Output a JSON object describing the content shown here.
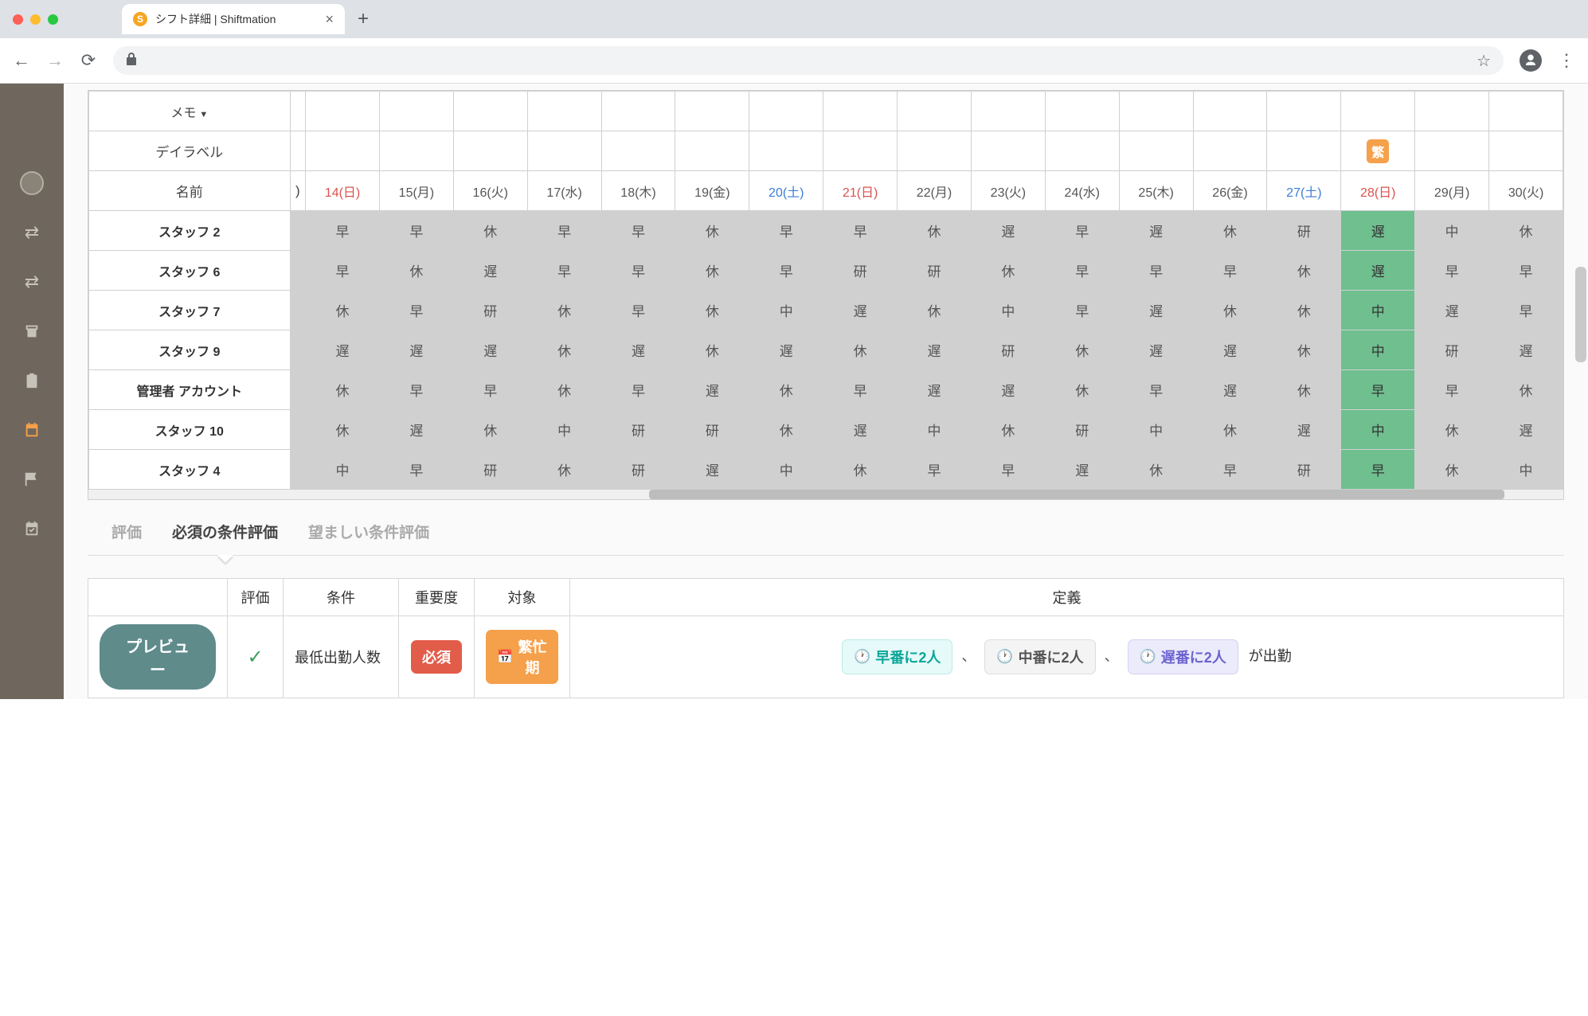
{
  "browser": {
    "tab_title": "シフト詳細 | Shiftmation"
  },
  "schedule": {
    "memo_label": "メモ",
    "daylabel_label": "デイラベル",
    "name_label": "名前",
    "busy_tag": "繁",
    "dates": [
      {
        "label": ")",
        "type": ""
      },
      {
        "label": "14(日)",
        "type": "sun"
      },
      {
        "label": "15(月)",
        "type": ""
      },
      {
        "label": "16(火)",
        "type": ""
      },
      {
        "label": "17(水)",
        "type": ""
      },
      {
        "label": "18(木)",
        "type": ""
      },
      {
        "label": "19(金)",
        "type": ""
      },
      {
        "label": "20(土)",
        "type": "sat"
      },
      {
        "label": "21(日)",
        "type": "sun"
      },
      {
        "label": "22(月)",
        "type": ""
      },
      {
        "label": "23(火)",
        "type": ""
      },
      {
        "label": "24(水)",
        "type": ""
      },
      {
        "label": "25(木)",
        "type": ""
      },
      {
        "label": "26(金)",
        "type": ""
      },
      {
        "label": "27(土)",
        "type": "sat"
      },
      {
        "label": "28(日)",
        "type": "sun"
      },
      {
        "label": "29(月)",
        "type": ""
      },
      {
        "label": "30(火)",
        "type": ""
      }
    ],
    "rows": [
      {
        "name": "スタッフ 2",
        "shifts": [
          "",
          "早",
          "早",
          "休",
          "早",
          "早",
          "休",
          "早",
          "早",
          "休",
          "遅",
          "早",
          "遅",
          "休",
          "研",
          "遅",
          "中",
          "休"
        ]
      },
      {
        "name": "スタッフ 6",
        "shifts": [
          "",
          "早",
          "休",
          "遅",
          "早",
          "早",
          "休",
          "早",
          "研",
          "研",
          "休",
          "早",
          "早",
          "早",
          "休",
          "遅",
          "早",
          "早"
        ]
      },
      {
        "name": "スタッフ 7",
        "shifts": [
          "",
          "休",
          "早",
          "研",
          "休",
          "早",
          "休",
          "中",
          "遅",
          "休",
          "中",
          "早",
          "遅",
          "休",
          "休",
          "中",
          "遅",
          "早"
        ]
      },
      {
        "name": "スタッフ 9",
        "shifts": [
          "",
          "遅",
          "遅",
          "遅",
          "休",
          "遅",
          "休",
          "遅",
          "休",
          "遅",
          "研",
          "休",
          "遅",
          "遅",
          "休",
          "中",
          "研",
          "遅"
        ]
      },
      {
        "name": "管理者 アカウント",
        "shifts": [
          "",
          "休",
          "早",
          "早",
          "休",
          "早",
          "遅",
          "休",
          "早",
          "遅",
          "遅",
          "休",
          "早",
          "遅",
          "休",
          "早",
          "早",
          "休"
        ]
      },
      {
        "name": "スタッフ 10",
        "shifts": [
          "",
          "休",
          "遅",
          "休",
          "中",
          "研",
          "研",
          "休",
          "遅",
          "中",
          "休",
          "研",
          "中",
          "休",
          "遅",
          "中",
          "休",
          "遅"
        ]
      },
      {
        "name": "スタッフ 4",
        "shifts": [
          "",
          "中",
          "早",
          "研",
          "休",
          "研",
          "遅",
          "中",
          "休",
          "早",
          "早",
          "遅",
          "休",
          "早",
          "研",
          "早",
          "休",
          "中"
        ]
      }
    ],
    "highlight_col": 15
  },
  "eval_tabs": {
    "summary": "評価",
    "required": "必須の条件評価",
    "preferred": "望ましい条件評価"
  },
  "cond_table": {
    "headers": {
      "eval": "評価",
      "condition": "条件",
      "importance": "重要度",
      "target": "対象",
      "definition": "定義"
    },
    "row": {
      "preview_btn": "プレビュー",
      "condition": "最低出勤人数",
      "importance": "必須",
      "target": "繁忙期",
      "def_early": "早番に2人",
      "def_mid": "中番に2人",
      "def_late": "遅番に2人",
      "def_trail": "が出勤",
      "comma": "、"
    }
  }
}
